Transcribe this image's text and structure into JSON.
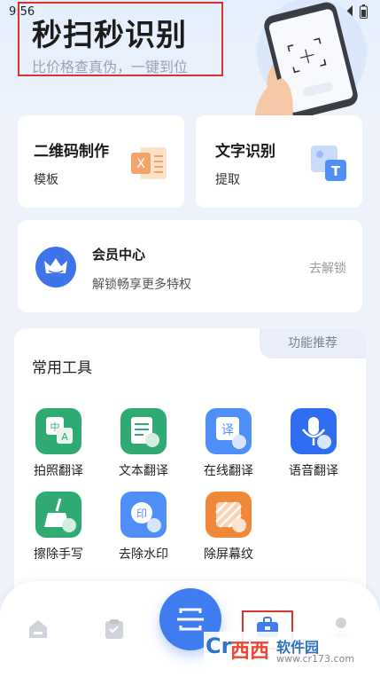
{
  "status_bar": {
    "time": "9:56"
  },
  "hero": {
    "title": "秒扫秒识别",
    "subtitle": "比价格查真伪，一键到位"
  },
  "feature_cards": [
    {
      "title": "二维码制作",
      "sub": "模板"
    },
    {
      "title": "文字识别",
      "sub": "提取"
    }
  ],
  "vip": {
    "title": "会员中心",
    "sub": "解锁畅享更多特权",
    "action": "去解锁"
  },
  "tools": {
    "tab_label": "功能推荐",
    "heading": "常用工具",
    "items": [
      {
        "label": "拍照翻译",
        "color": "#2faa73"
      },
      {
        "label": "文本翻译",
        "color": "#2faa73"
      },
      {
        "label": "在线翻译",
        "color": "#4f8ff7"
      },
      {
        "label": "语音翻译",
        "color": "#2f6ef0"
      },
      {
        "label": "擦除手写",
        "color": "#2faa73"
      },
      {
        "label": "去除水印",
        "color": "#4f8ff7"
      },
      {
        "label": "除屏幕纹",
        "color": "#f0883a"
      }
    ]
  },
  "watermark": {
    "brand": "软件园",
    "url": "www.cr173.com"
  },
  "colors": {
    "accent": "#3f7cf0",
    "highlight_border": "#d9342b"
  }
}
